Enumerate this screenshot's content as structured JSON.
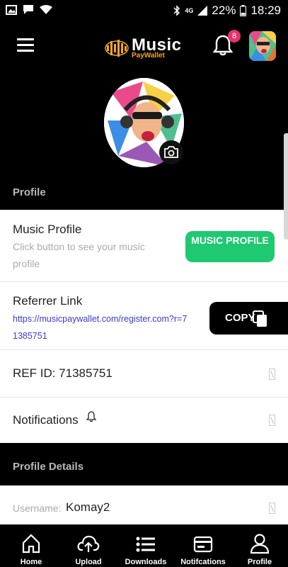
{
  "status_bar": {
    "battery_percent": "22%",
    "time": "18:29",
    "network": "4G"
  },
  "header": {
    "logo_title": "Music",
    "logo_subtitle": "PayWallet",
    "notification_count": "8"
  },
  "sections": {
    "profile": "Profile",
    "profile_details": "Profile Details"
  },
  "music_profile": {
    "title": "Music Profile",
    "description": "Click button to see your music profile",
    "button_label": "MUSIC PROFILE"
  },
  "referrer": {
    "title": "Referrer Link",
    "link": "https://musicpaywallet.com/register.com?r=71385751",
    "button_label": "COPY"
  },
  "ref_id": {
    "label": "REF ID: 71385751"
  },
  "notifications_row": {
    "label": "Notifications"
  },
  "username": {
    "label": "Username:",
    "value": "Komay2"
  },
  "bottom_nav": {
    "items": [
      {
        "label": "Home",
        "icon": "home-icon"
      },
      {
        "label": "Upload",
        "icon": "cloud-upload-icon"
      },
      {
        "label": "Downloads",
        "icon": "list-icon"
      },
      {
        "label": "Notifcations",
        "icon": "card-icon"
      },
      {
        "label": "Profile",
        "icon": "user-icon"
      }
    ]
  },
  "colors": {
    "accent_green": "#1ec971",
    "badge_pink": "#e8326d",
    "link_blue": "#3a3ad0",
    "logo_orange": "#f5a623"
  }
}
